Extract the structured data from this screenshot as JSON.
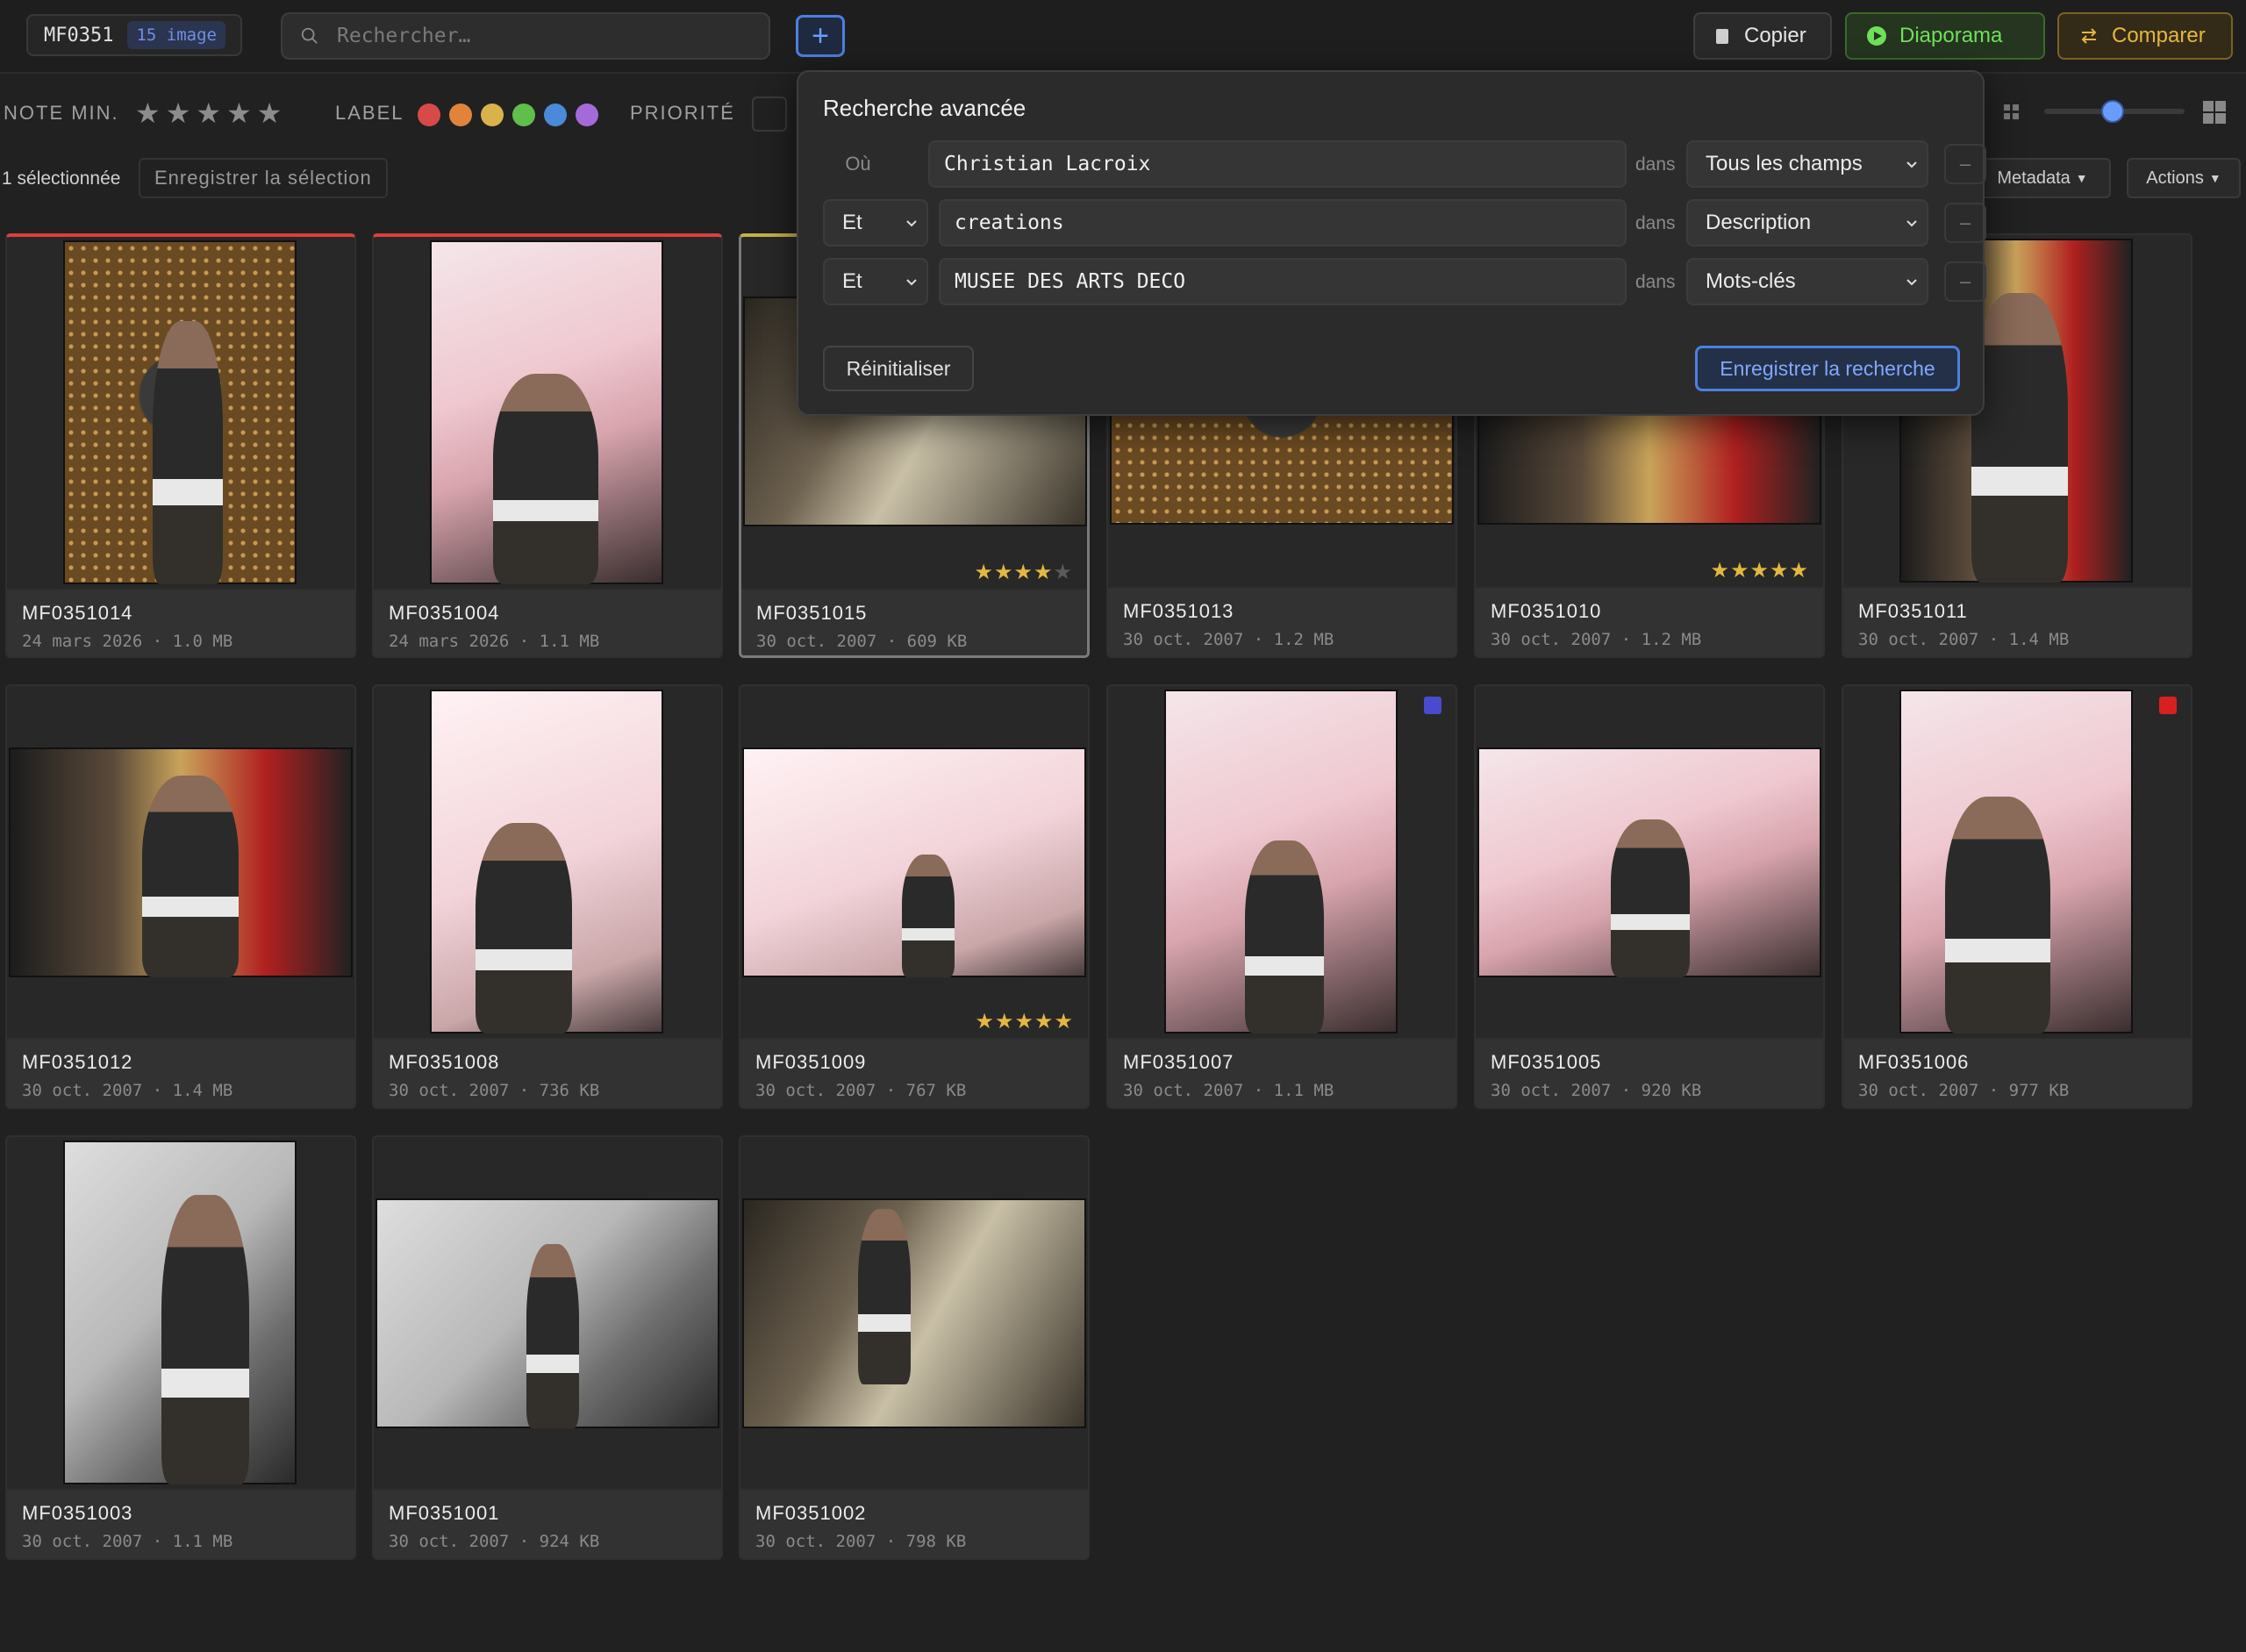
{
  "topbar": {
    "collection_name": "MF0351",
    "collection_count": "15 image",
    "search_placeholder": "Rechercher…",
    "copy_label": "Copier",
    "slideshow_label": "Diaporama",
    "compare_label": "Comparer"
  },
  "filters": {
    "rating_label": "NOTE MIN.",
    "rating_stars": "★★★★★",
    "label_label": "LABEL",
    "label_colors": [
      "#d84a4a",
      "#e0843c",
      "#d9b24a",
      "#5fbf4a",
      "#4a8ad9",
      "#a46ad9"
    ],
    "priority_label": "PRIORITÉ"
  },
  "selection": {
    "count_text": "1 sélectionnée",
    "save_selection": "Enregistrer la sélection",
    "metadata_label": "Metadata",
    "actions_label": "Actions"
  },
  "advanced_search": {
    "title": "Recherche avancée",
    "rows": [
      {
        "operator": "Où",
        "term": "Christian Lacroix",
        "in": "dans",
        "field": "Tous les champs",
        "remove": "–"
      },
      {
        "operator": "Et",
        "term": "creations",
        "in": "dans",
        "field": "Description",
        "remove": "–"
      },
      {
        "operator": "Et",
        "term": "MUSEE DES ARTS DECO",
        "in": "dans",
        "field": "Mots-clés",
        "remove": "–"
      }
    ],
    "reset_label": "Réinitialiser",
    "save_label": "Enregistrer la recherche"
  },
  "images": [
    {
      "id": "MF0351014",
      "date": "24 mars 2026",
      "size": "1.0 MB",
      "rating": 0
    },
    {
      "id": "MF0351004",
      "date": "24 mars 2026",
      "size": "1.1 MB",
      "rating": 0
    },
    {
      "id": "MF0351015",
      "date": "30 oct. 2007",
      "size": "609 KB",
      "rating": 4,
      "stars": "★★★★",
      "stars_off": "★"
    },
    {
      "id": "MF0351013",
      "date": "30 oct. 2007",
      "size": "1.2 MB",
      "rating": 0
    },
    {
      "id": "MF0351010",
      "date": "30 oct. 2007",
      "size": "1.2 MB",
      "rating": 5,
      "stars": "★★★★★"
    },
    {
      "id": "MF0351011",
      "date": "30 oct. 2007",
      "size": "1.4 MB",
      "rating": 0
    },
    {
      "id": "MF0351012",
      "date": "30 oct. 2007",
      "size": "1.4 MB",
      "rating": 0
    },
    {
      "id": "MF0351008",
      "date": "30 oct. 2007",
      "size": "736 KB",
      "rating": 0
    },
    {
      "id": "MF0351009",
      "date": "30 oct. 2007",
      "size": "767 KB",
      "rating": 5,
      "stars": "★★★★★"
    },
    {
      "id": "MF0351007",
      "date": "30 oct. 2007",
      "size": "1.1 MB",
      "rating": 0,
      "tag_color": "#4a4ad0"
    },
    {
      "id": "MF0351005",
      "date": "30 oct. 2007",
      "size": "920 KB",
      "rating": 0
    },
    {
      "id": "MF0351006",
      "date": "30 oct. 2007",
      "size": "977 KB",
      "rating": 0,
      "tag_color": "#d82020"
    },
    {
      "id": "MF0351003",
      "date": "30 oct. 2007",
      "size": "1.1 MB",
      "rating": 0
    },
    {
      "id": "MF0351001",
      "date": "30 oct. 2007",
      "size": "924 KB",
      "rating": 0
    },
    {
      "id": "MF0351002",
      "date": "30 oct. 2007",
      "size": "798 KB",
      "rating": 0
    }
  ],
  "separator": "·"
}
